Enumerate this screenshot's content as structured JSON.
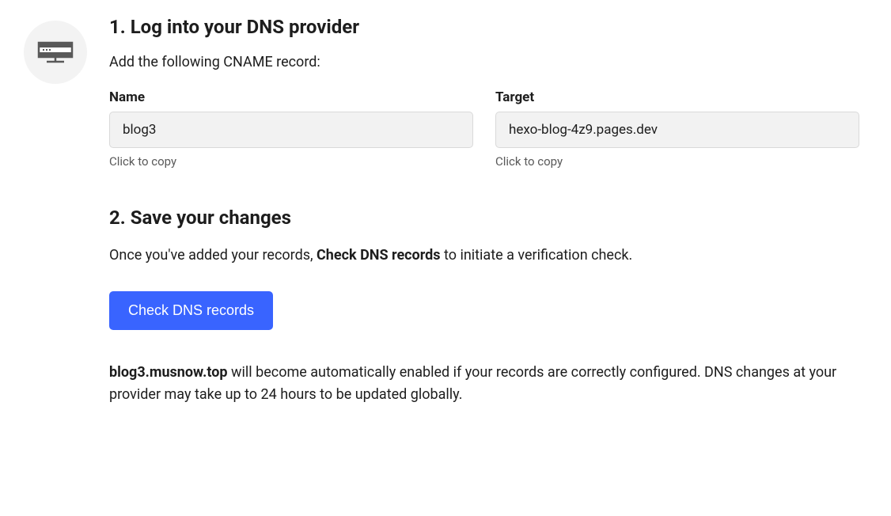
{
  "step1": {
    "heading": "1. Log into your DNS provider",
    "subtitle": "Add the following CNAME record:",
    "name_label": "Name",
    "name_value": "blog3",
    "name_copy_hint": "Click to copy",
    "target_label": "Target",
    "target_value": "hexo-blog-4z9.pages.dev",
    "target_copy_hint": "Click to copy"
  },
  "step2": {
    "heading": "2. Save your changes",
    "text_before": "Once you've added your records, ",
    "text_bold": "Check DNS records",
    "text_after": " to initiate a verification check.",
    "button_label": "Check DNS records",
    "domain": "blog3.musnow.top",
    "info_after": " will become automatically enabled if your records are correctly configured. DNS changes at your provider may take up to 24 hours to be updated globally."
  }
}
